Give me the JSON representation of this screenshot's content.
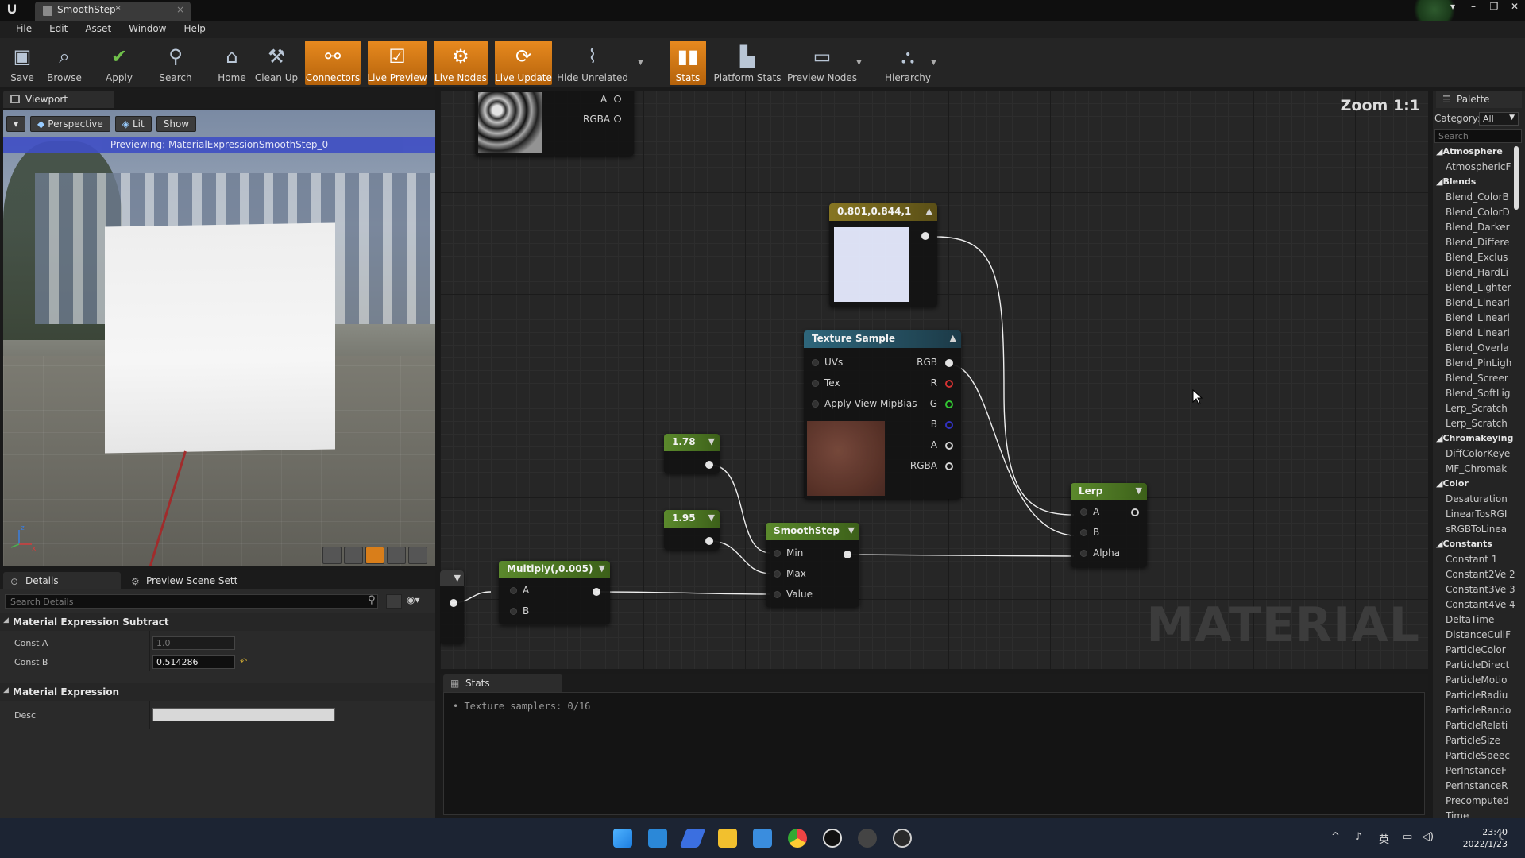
{
  "window": {
    "doc_tab": "SmoothStep*"
  },
  "menu": [
    "File",
    "Edit",
    "Asset",
    "Window",
    "Help"
  ],
  "toolbar": {
    "save": "Save",
    "browse": "Browse",
    "apply": "Apply",
    "search": "Search",
    "home": "Home",
    "clean_up": "Clean Up",
    "connectors": "Connectors",
    "live_preview": "Live Preview",
    "live_nodes": "Live Nodes",
    "live_update": "Live Update",
    "hide_unrelated": "Hide Unrelated",
    "stats": "Stats",
    "platform_stats": "Platform Stats",
    "preview_nodes": "Preview Nodes",
    "hierarchy": "Hierarchy"
  },
  "viewport": {
    "tab": "Viewport",
    "perspective": "Perspective",
    "lit": "Lit",
    "show": "Show",
    "previewing": "Previewing: MaterialExpressionSmoothStep_0"
  },
  "details": {
    "tab_details": "Details",
    "tab_preview_scene": "Preview Scene Sett",
    "search_placeholder": "Search Details",
    "section1": "Material Expression Subtract",
    "const_a_label": "Const A",
    "const_a_value": "1.0",
    "const_b_label": "Const B",
    "const_b_value": "0.514286",
    "section2": "Material Expression",
    "desc_label": "Desc",
    "desc_value": ""
  },
  "graph": {
    "zoom": "Zoom 1:1",
    "watermark": "MATERIAL",
    "top_tex_pins": [
      "A",
      "RGBA"
    ],
    "color_node_title": "0.801,0.844,1",
    "texture_sample": {
      "title": "Texture Sample",
      "inputs": [
        "UVs",
        "Tex",
        "Apply View MipBias"
      ],
      "outputs": [
        "RGB",
        "R",
        "G",
        "B",
        "A",
        "RGBA"
      ]
    },
    "const1": "1.78",
    "const2": "1.95",
    "smoothstep": {
      "title": "SmoothStep",
      "inputs": [
        "Min",
        "Max",
        "Value"
      ]
    },
    "multiply": {
      "title": "Multiply(,0.005)",
      "inputs": [
        "A",
        "B"
      ]
    },
    "lerp": {
      "title": "Lerp",
      "inputs": [
        "A",
        "B",
        "Alpha"
      ]
    }
  },
  "stats": {
    "tab": "Stats",
    "line": "• Texture samplers: 0/16"
  },
  "palette": {
    "tab": "Palette",
    "category_label": "Category:",
    "category_value": "All",
    "search_placeholder": "Search",
    "groups": [
      {
        "name": "Atmosphere",
        "items": [
          "AtmosphericF"
        ]
      },
      {
        "name": "Blends",
        "items": [
          "Blend_ColorB",
          "Blend_ColorD",
          "Blend_Darker",
          "Blend_Differe",
          "Blend_Exclus",
          "Blend_HardLi",
          "Blend_Lighter",
          "Blend_Linearl",
          "Blend_Linearl",
          "Blend_Linearl",
          "Blend_Overla",
          "Blend_PinLigh",
          "Blend_Screer",
          "Blend_SoftLig",
          "Lerp_Scratch",
          "Lerp_Scratch"
        ]
      },
      {
        "name": "Chromakeying",
        "items": [
          "DiffColorKeye",
          "MF_Chromak"
        ]
      },
      {
        "name": "Color",
        "items": [
          "Desaturation",
          "LinearTosRGI",
          "sRGBToLinea"
        ]
      },
      {
        "name": "Constants",
        "items": [
          "Constant   1",
          "Constant2Ve 2",
          "Constant3Ve 3",
          "Constant4Ve 4",
          "DeltaTime",
          "DistanceCullF",
          "ParticleColor",
          "ParticleDirect",
          "ParticleMotio",
          "ParticleRadiu",
          "ParticleRando",
          "ParticleRelati",
          "ParticleSize",
          "ParticleSpeec",
          "PerInstanceF",
          "PerInstanceR",
          "Precomputed",
          "Time"
        ]
      }
    ]
  },
  "taskbar": {
    "time": "23:40",
    "date": "2022/1/23",
    "ime": "英"
  },
  "colors": {
    "accent_orange": "#e88a1f",
    "preview_banner": "#3f4fc4",
    "node_green": "#4f7a2a",
    "node_teal": "#2b5a6e",
    "node_gold": "#7a6a1c"
  }
}
